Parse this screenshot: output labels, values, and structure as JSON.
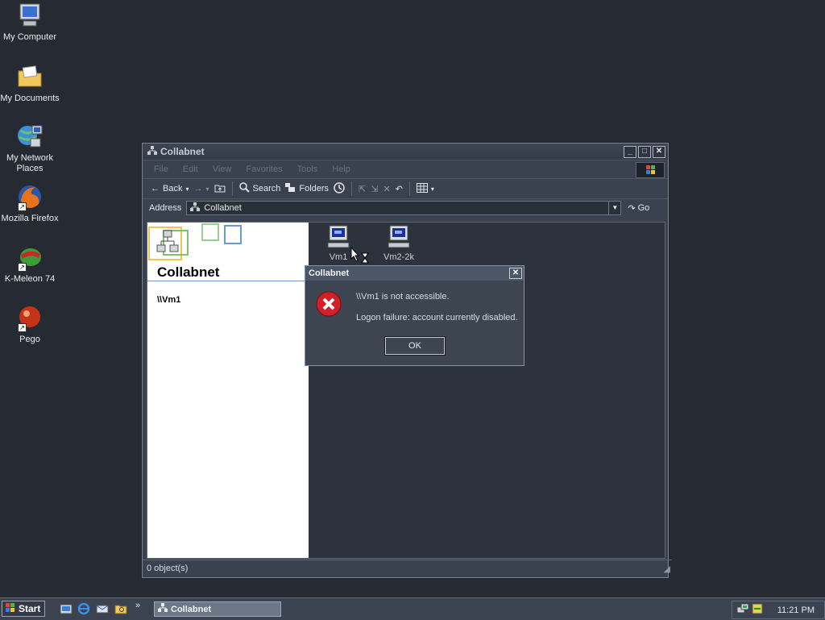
{
  "desktop": {
    "icons": [
      {
        "label": "My Computer"
      },
      {
        "label": "My Documents"
      },
      {
        "label": "My Network Places"
      },
      {
        "label": "Mozilla Firefox"
      },
      {
        "label": "K-Meleon 74"
      },
      {
        "label": "Pego"
      }
    ]
  },
  "window": {
    "title": "Collabnet",
    "menu": [
      "File",
      "Edit",
      "View",
      "Favorites",
      "Tools",
      "Help"
    ],
    "toolbar": {
      "back": "Back",
      "search": "Search",
      "folders": "Folders"
    },
    "address": {
      "label": "Address",
      "value": "Collabnet",
      "go": "Go"
    },
    "left_pane": {
      "title": "Collabnet",
      "path": "\\\\Vm1"
    },
    "items": [
      {
        "label": "Vm1"
      },
      {
        "label": "Vm2-2k"
      }
    ],
    "status": "0 object(s)"
  },
  "dialog": {
    "title": "Collabnet",
    "line1": "\\\\Vm1 is not accessible.",
    "line2": "Logon failure: account currently disabled.",
    "ok": "OK"
  },
  "taskbar": {
    "start": "Start",
    "task": "Collabnet",
    "clock": "11:21 PM",
    "more": "»"
  },
  "colors": {
    "desktop": "#262b33",
    "error": "#d0202a",
    "taskbar": "#3b4350"
  }
}
